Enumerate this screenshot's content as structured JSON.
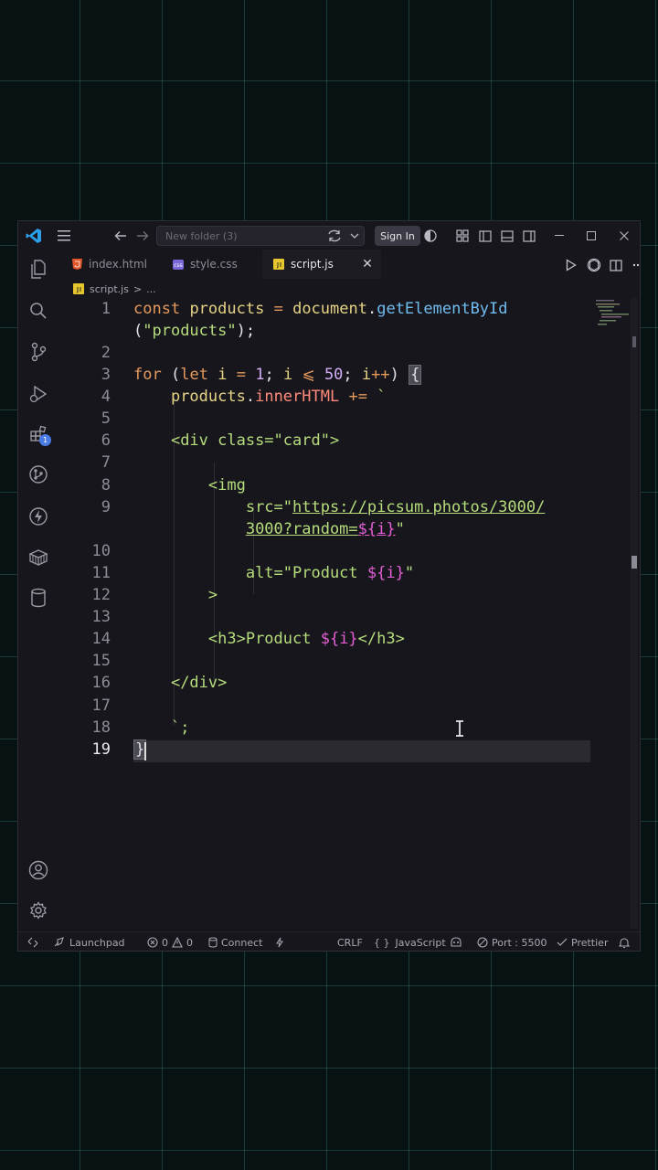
{
  "titlebar": {
    "search_placeholder": "New folder (3)",
    "signin_label": "Sign In"
  },
  "tabs": [
    {
      "label": "index.html",
      "icon": "html-file-icon",
      "color": "#e2562c"
    },
    {
      "label": "style.css",
      "icon": "css-file-icon",
      "color": "#7b68d8"
    },
    {
      "label": "script.js",
      "icon": "js-file-icon",
      "color": "#e5c62c",
      "active": true
    }
  ],
  "breadcrumb": {
    "file": "script.js",
    "separator": ">",
    "rest": "..."
  },
  "editor": {
    "language": "JavaScript",
    "current_line": 19,
    "line_numbers": [
      "1",
      "2",
      "3",
      "4",
      "5",
      "6",
      "7",
      "8",
      "9",
      "10",
      "11",
      "12",
      "13",
      "14",
      "15",
      "16",
      "17",
      "18",
      "19"
    ],
    "lines": {
      "l1a": "const",
      "l1b": "products",
      "l1c": "=",
      "l1d": "document",
      "l1e": ".",
      "l1f": "getElementById",
      "l1g": "(",
      "l1h": "\"products\"",
      "l1i": ");",
      "l3a": "for",
      "l3b": "(",
      "l3c": "let",
      "l3d": "i",
      "l3e": "=",
      "l3f": "1",
      "l3g": ";",
      "l3h": "i",
      "l3i": "⩽",
      "l3j": "50",
      "l3k": ";",
      "l3l": "i",
      "l3m": "++",
      "l3n": ")",
      "l3o": "{",
      "l4a": "products",
      "l4b": ".",
      "l4c": "innerHTML",
      "l4d": "+=",
      "l4e": "`",
      "l6": "<div class=\"card\">",
      "l8": "<img",
      "l9a": "src=\"",
      "l9b": "https://picsum.photos/3000/",
      "l9c": "3000?random=",
      "l9d": "${i}",
      "l9e": "\"",
      "l11a": "alt=\"Product ",
      "l11b": "${i}",
      "l11c": "\"",
      "l12": ">",
      "l14a": "<h3>Product ",
      "l14b": "${i}",
      "l14c": "</h3>",
      "l16": "</div>",
      "l18": "`;",
      "l19": "}"
    }
  },
  "statusbar": {
    "launchpad": "Launchpad",
    "errors": "0",
    "warnings": "0",
    "connect": "Connect",
    "eol": "CRLF",
    "braces": "{ }",
    "language": "JavaScript",
    "port": "Port : 5500",
    "prettier": "Prettier"
  }
}
